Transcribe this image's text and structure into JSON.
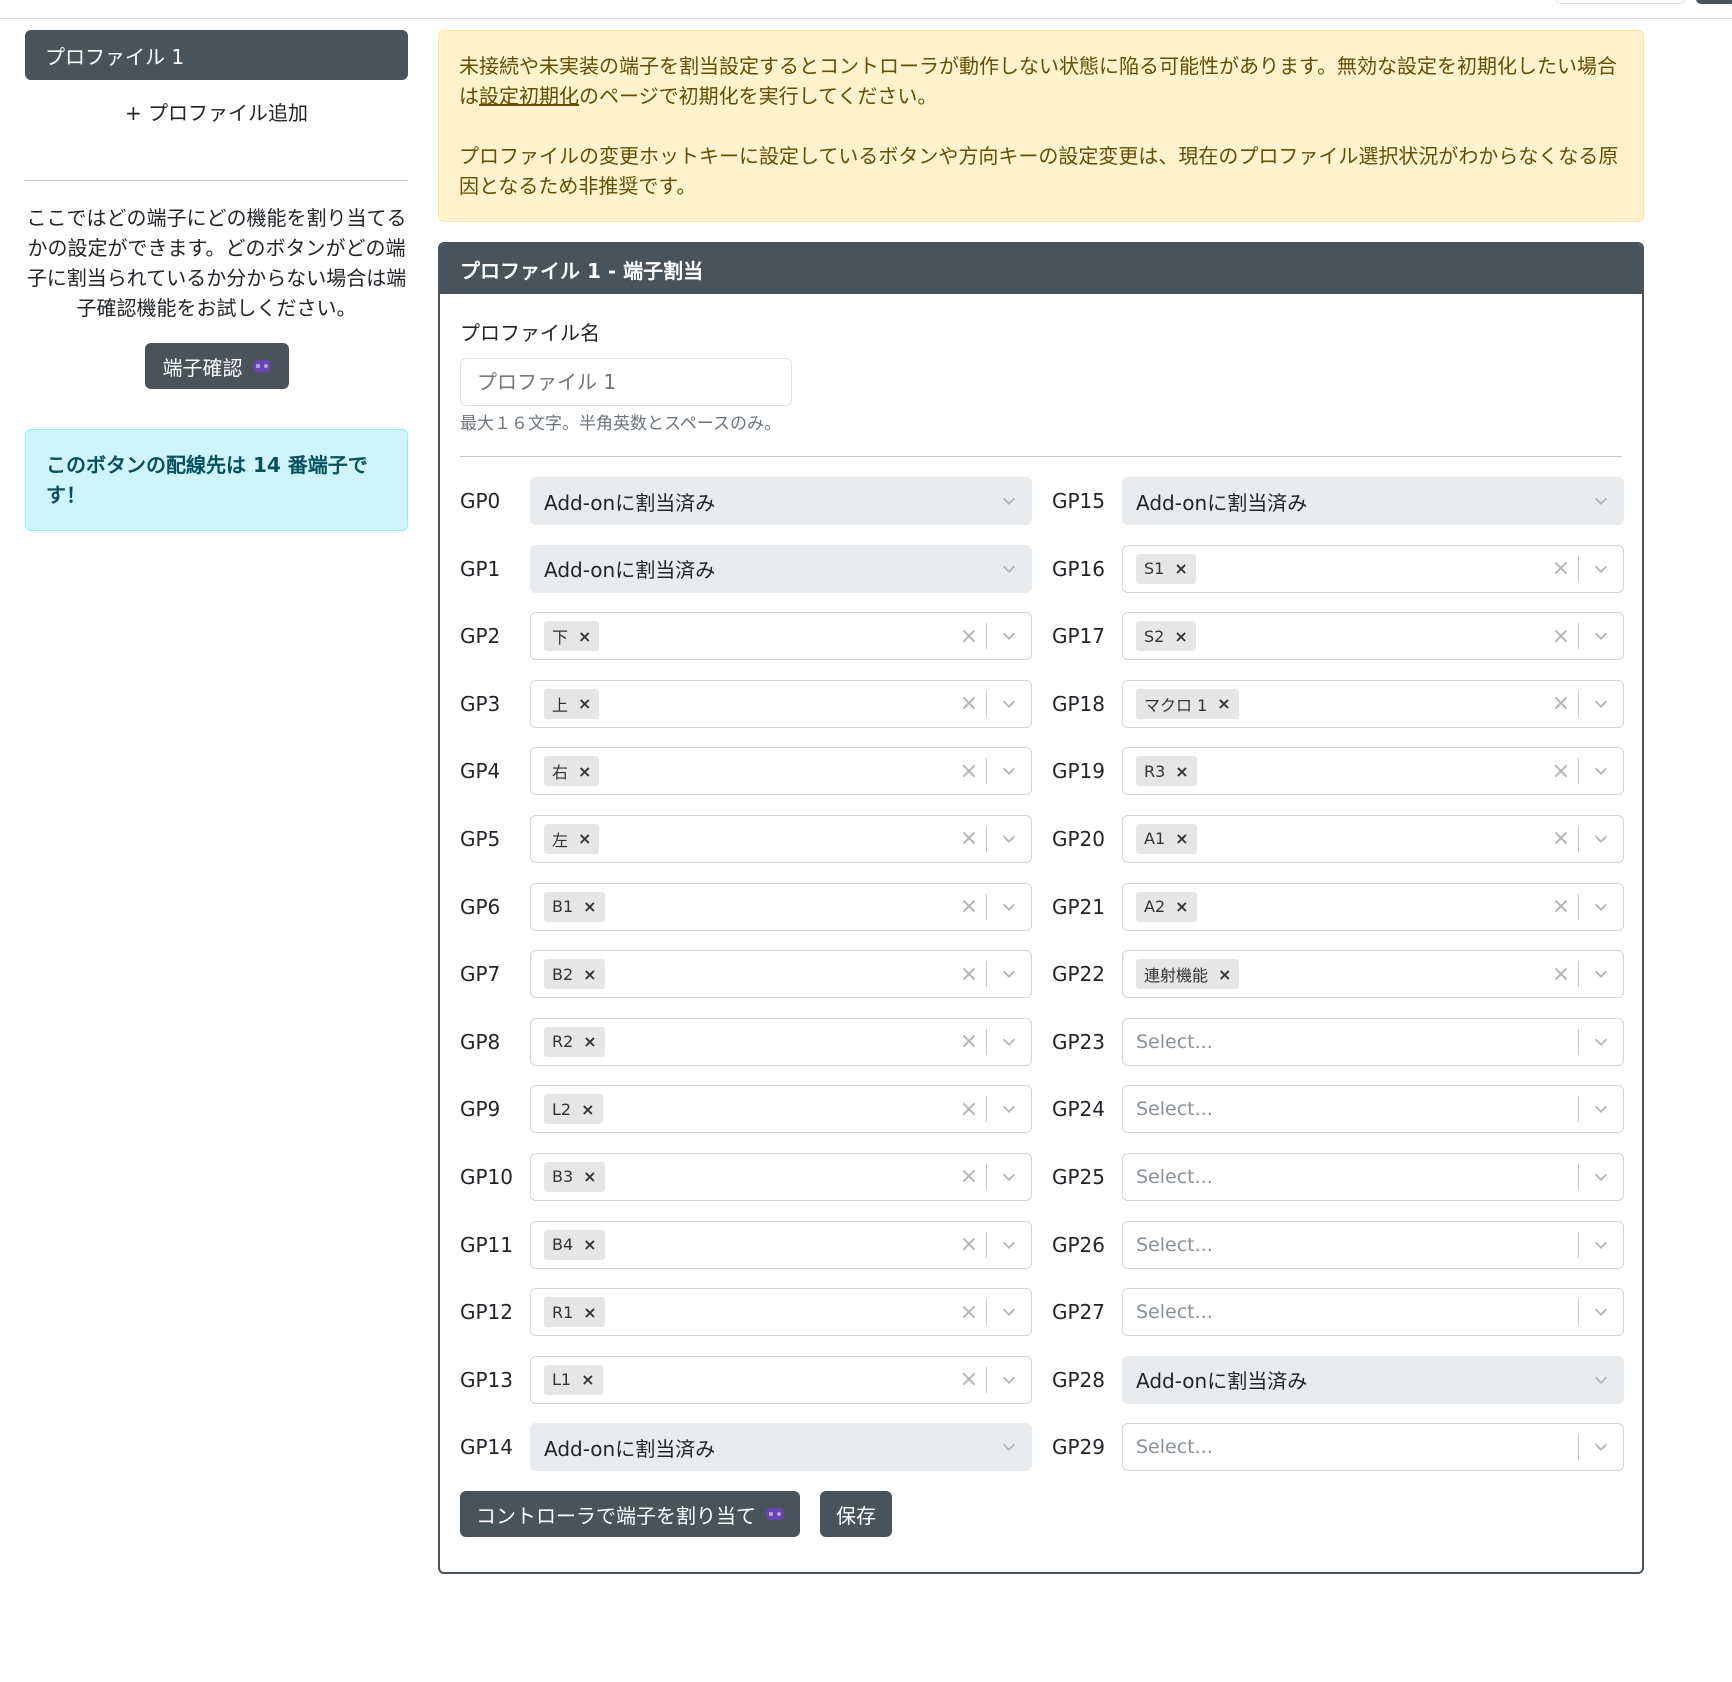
{
  "sidebar": {
    "profile_tab": "プロファイル 1",
    "add_profile": "+ プロファイル追加",
    "description": "ここではどの端子にどの機能を割り当てるかの設定ができます。どのボタンがどの端子に割当られているか分からない場合は端子確認機能をお試しください。",
    "check_button": "端子確認",
    "info_alert": "このボタンの配線先は 14 番端子です！"
  },
  "warning": {
    "line1_pre": "未接続や未実装の端子を割当設定するとコントローラが動作しない状態に陥る可能性があります。無効な設定を初期化したい場合は",
    "line1_link": "設定初期化",
    "line1_post": "のページで初期化を実行してください。",
    "line2": "プロファイルの変更ホットキーに設定しているボタンや方向キーの設定変更は、現在のプロファイル選択状況がわからなくなる原因となるため非推奨です。"
  },
  "card": {
    "title": "プロファイル 1 - 端子割当",
    "name_label": "プロファイル名",
    "name_placeholder": "プロファイル 1",
    "name_help": "最大１６文字。半角英数とスペースのみ。",
    "assign_button": "コントローラで端子を割り当て",
    "save_button": "保存"
  },
  "pins_left": [
    {
      "label": "GP0",
      "type": "disabled",
      "value": "Add-onに割当済み"
    },
    {
      "label": "GP1",
      "type": "disabled",
      "value": "Add-onに割当済み"
    },
    {
      "label": "GP2",
      "type": "tag",
      "value": "下"
    },
    {
      "label": "GP3",
      "type": "tag",
      "value": "上"
    },
    {
      "label": "GP4",
      "type": "tag",
      "value": "右"
    },
    {
      "label": "GP5",
      "type": "tag",
      "value": "左"
    },
    {
      "label": "GP6",
      "type": "tag",
      "value": "B1"
    },
    {
      "label": "GP7",
      "type": "tag",
      "value": "B2"
    },
    {
      "label": "GP8",
      "type": "tag",
      "value": "R2"
    },
    {
      "label": "GP9",
      "type": "tag",
      "value": "L2"
    },
    {
      "label": "GP10",
      "type": "tag",
      "value": "B3"
    },
    {
      "label": "GP11",
      "type": "tag",
      "value": "B4"
    },
    {
      "label": "GP12",
      "type": "tag",
      "value": "R1"
    },
    {
      "label": "GP13",
      "type": "tag",
      "value": "L1"
    },
    {
      "label": "GP14",
      "type": "disabled",
      "value": "Add-onに割当済み"
    }
  ],
  "pins_right": [
    {
      "label": "GP15",
      "type": "disabled",
      "value": "Add-onに割当済み"
    },
    {
      "label": "GP16",
      "type": "tag",
      "value": "S1"
    },
    {
      "label": "GP17",
      "type": "tag",
      "value": "S2"
    },
    {
      "label": "GP18",
      "type": "tag",
      "value": "マクロ 1"
    },
    {
      "label": "GP19",
      "type": "tag",
      "value": "R3"
    },
    {
      "label": "GP20",
      "type": "tag",
      "value": "A1"
    },
    {
      "label": "GP21",
      "type": "tag",
      "value": "A2"
    },
    {
      "label": "GP22",
      "type": "tag",
      "value": "連射機能"
    },
    {
      "label": "GP23",
      "type": "empty",
      "value": "Select..."
    },
    {
      "label": "GP24",
      "type": "empty",
      "value": "Select..."
    },
    {
      "label": "GP25",
      "type": "empty",
      "value": "Select..."
    },
    {
      "label": "GP26",
      "type": "empty",
      "value": "Select..."
    },
    {
      "label": "GP27",
      "type": "empty",
      "value": "Select..."
    },
    {
      "label": "GP28",
      "type": "disabled",
      "value": "Add-onに割当済み"
    },
    {
      "label": "GP29",
      "type": "empty",
      "value": "Select..."
    }
  ],
  "icons": {
    "gamepad": "gamepad-icon",
    "chevron": "chevron-down-icon",
    "clear": "clear-icon",
    "tag_remove": "tag-remove-icon"
  },
  "colors": {
    "dark": "#4a525a",
    "warning_bg": "#fff3cd",
    "warning_text": "#664d03",
    "info_bg": "#cff4fc",
    "info_text": "#055160",
    "disabled_bg": "#e9ecef"
  }
}
